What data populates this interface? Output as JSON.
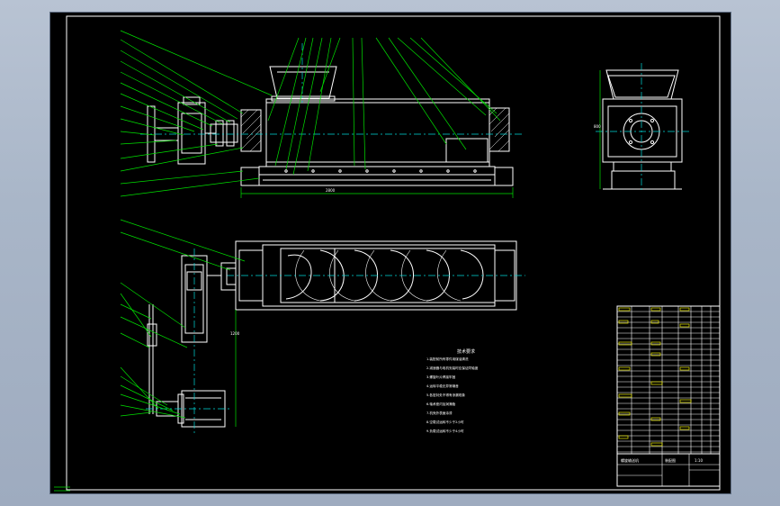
{
  "drawing": {
    "notes_heading": "技术要求",
    "notes_lines": [
      "1.装配前所有零件用煤油清洗",
      "2.减速器与电机安装时应保证同轴度",
      "3.螺旋叶片焊接牢固",
      "4.运转平稳无异常噪音",
      "5.各密封处不得有渗漏现象",
      "6.轴承座内加润滑脂",
      "7.机壳外表面涂漆",
      "8.空载试运转不少于2小时",
      "9.负载试运转不少于4小时"
    ],
    "dim_length": "2800",
    "dim_height": "1200",
    "dim_side": "800",
    "title_block": {
      "label_left": "螺旋输送机",
      "label_mid": "装配图",
      "label_right": "1:10"
    }
  },
  "colors": {
    "outline": "#ffffff",
    "leader": "#00e000",
    "centerline": "#00d8d8",
    "table": "#e8e800",
    "background": "#000000"
  }
}
